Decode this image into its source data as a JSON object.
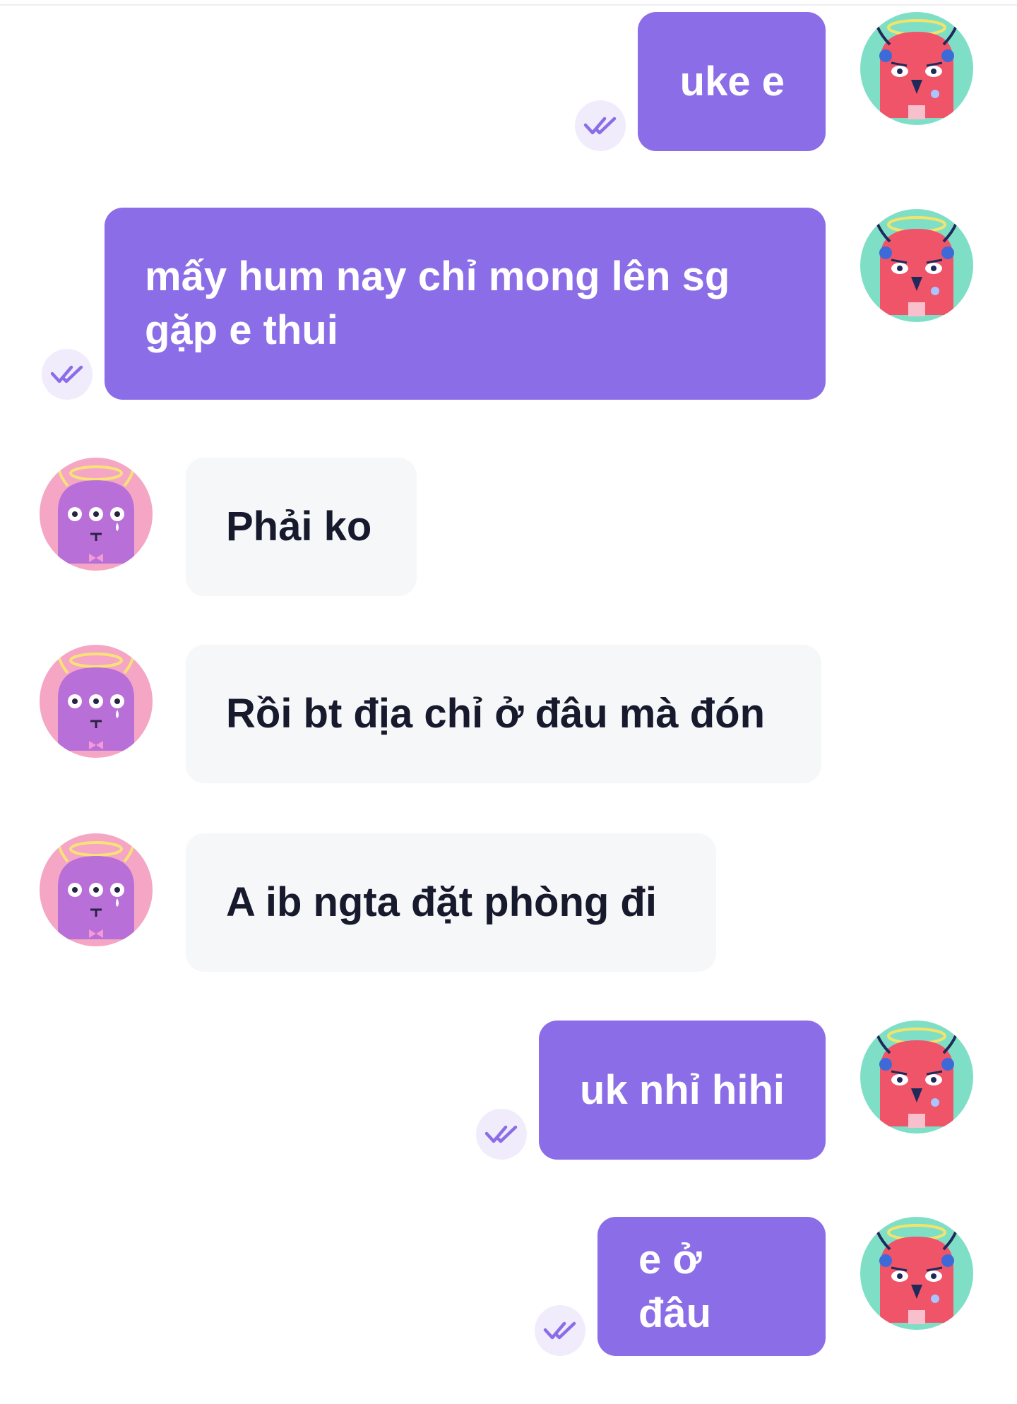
{
  "conversation": {
    "messages": [
      {
        "direction": "outgoing",
        "text": "uke e",
        "status_icon": "double-check-icon",
        "avatar": "red-monster-avatar"
      },
      {
        "direction": "outgoing",
        "lines": [
          "mấy hum nay chỉ mong lên sg",
          "gặp e thui"
        ],
        "status_icon": "double-check-icon",
        "avatar": "red-monster-avatar"
      },
      {
        "direction": "incoming",
        "text": "Phải ko",
        "avatar": "purple-monster-avatar"
      },
      {
        "direction": "incoming",
        "text": "Rồi bt địa chỉ ở đâu mà đón",
        "avatar": "purple-monster-avatar"
      },
      {
        "direction": "incoming",
        "text": "A ib ngta đặt phòng đi",
        "avatar": "purple-monster-avatar"
      },
      {
        "direction": "outgoing",
        "text": "uk nhỉ hihi",
        "status_icon": "double-check-icon",
        "avatar": "red-monster-avatar"
      },
      {
        "direction": "outgoing",
        "text": "e ở đâu",
        "status_icon": "double-check-icon",
        "avatar": "red-monster-avatar"
      }
    ]
  },
  "colors": {
    "outgoing_bubble": "#8b6de8",
    "incoming_bubble": "#f6f7f9",
    "outgoing_text": "#ffffff",
    "incoming_text": "#161a2c",
    "read_tick": "#8b6de8",
    "read_tick_bg": "#f0ecfb",
    "red_avatar_bg": "#7fdfc6",
    "purple_avatar_bg": "#f4a6c4"
  }
}
